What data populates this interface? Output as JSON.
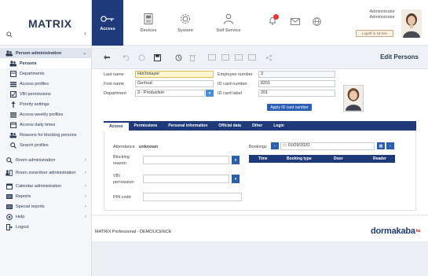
{
  "app": {
    "name": "MATRIX"
  },
  "sidebar": {
    "items": [
      {
        "label": "Person administration",
        "type": "group",
        "chevron": "⌄"
      },
      {
        "label": "Persons",
        "type": "active"
      },
      {
        "label": "Departments",
        "type": "sub"
      },
      {
        "label": "Access profiles",
        "type": "sub"
      },
      {
        "label": "VBI permissions",
        "type": "sub"
      },
      {
        "label": "Priority settings",
        "type": "sub"
      },
      {
        "label": "Access weekly profiles",
        "type": "sub"
      },
      {
        "label": "Access daily times",
        "type": "sub"
      },
      {
        "label": "Reasons for blocking persons",
        "type": "sub"
      },
      {
        "label": "Search profiles",
        "type": "sub"
      },
      {
        "label": "Room administration",
        "type": "item",
        "chevron": "›"
      },
      {
        "label": "Room zone/door administration",
        "type": "multi",
        "chevron": "›"
      },
      {
        "label": "Calendar administration",
        "type": "item",
        "chevron": "›"
      },
      {
        "label": "Reports",
        "type": "item",
        "chevron": "›"
      },
      {
        "label": "Special reports",
        "type": "item",
        "chevron": "›"
      },
      {
        "label": "Help",
        "type": "item",
        "chevron": "›"
      },
      {
        "label": "Logout",
        "type": "item"
      }
    ]
  },
  "header": {
    "tabs": [
      {
        "label": "Access",
        "icon": "key-icon"
      },
      {
        "label": "Devices",
        "icon": "device-icon"
      },
      {
        "label": "System",
        "icon": "gear-icon"
      },
      {
        "label": "Self Service",
        "icon": "person-icon"
      }
    ],
    "user_line1": "Administrator",
    "user_line2": "Administrator",
    "logoff_label": "Logoff in 19 min"
  },
  "toolbar": {
    "page_title": "Edit Persons"
  },
  "form": {
    "last_name_label": "Last name",
    "last_name_value": "Hochmayer",
    "first_name_label": "First name",
    "first_name_value": "Gertrud",
    "department_label": "Department",
    "department_value": "3 - Production",
    "employee_number_label": "Employee number",
    "employee_number_value": "3",
    "id_card_number_label": "ID card number",
    "id_card_number_value": "8201",
    "id_card_label_label": "ID card label",
    "id_card_label_value": "201",
    "apply_button": "Apply ID card number"
  },
  "subtabs": [
    "Access",
    "Permissions",
    "Personal information",
    "Official data",
    "Other",
    "Login"
  ],
  "access_tab": {
    "attendance_label": "Attendance",
    "attendance_value": "unknown",
    "blocking_reason_label": "Blocking reason",
    "vbi_permission_label": "VBI permission",
    "pin_code_label": "PIN code",
    "bookings_label": "Bookings",
    "bookings_date": "01/09/2020",
    "table_headers": [
      "Time",
      "Booking type",
      "Door",
      "Reader"
    ]
  },
  "footer": {
    "text": "MATRIX Professional - DEMOLICENCE",
    "brand": "dormakaba",
    "brand_suffix": "ka"
  },
  "colors": {
    "accent": "#1f3a7a",
    "highlight": "#fff6cf",
    "badge": "#e53935",
    "button": "#4a90d9"
  }
}
